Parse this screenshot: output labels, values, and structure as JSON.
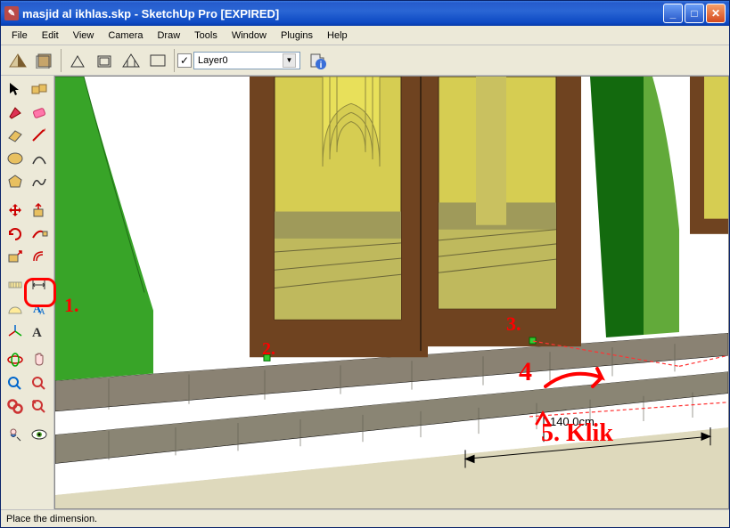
{
  "window": {
    "title": "masjid al ikhlas.skp - SketchUp Pro [EXPIRED]"
  },
  "menus": [
    "File",
    "Edit",
    "View",
    "Camera",
    "Draw",
    "Tools",
    "Window",
    "Plugins",
    "Help"
  ],
  "layer": {
    "selected": "Layer0"
  },
  "status": {
    "text": "Place the dimension."
  },
  "scene": {
    "dimension_label": "140.0cm"
  },
  "annotations": {
    "a1": "1.",
    "a2": "2.",
    "a3": "3.",
    "a4": "4",
    "a5": "5. Klik"
  }
}
